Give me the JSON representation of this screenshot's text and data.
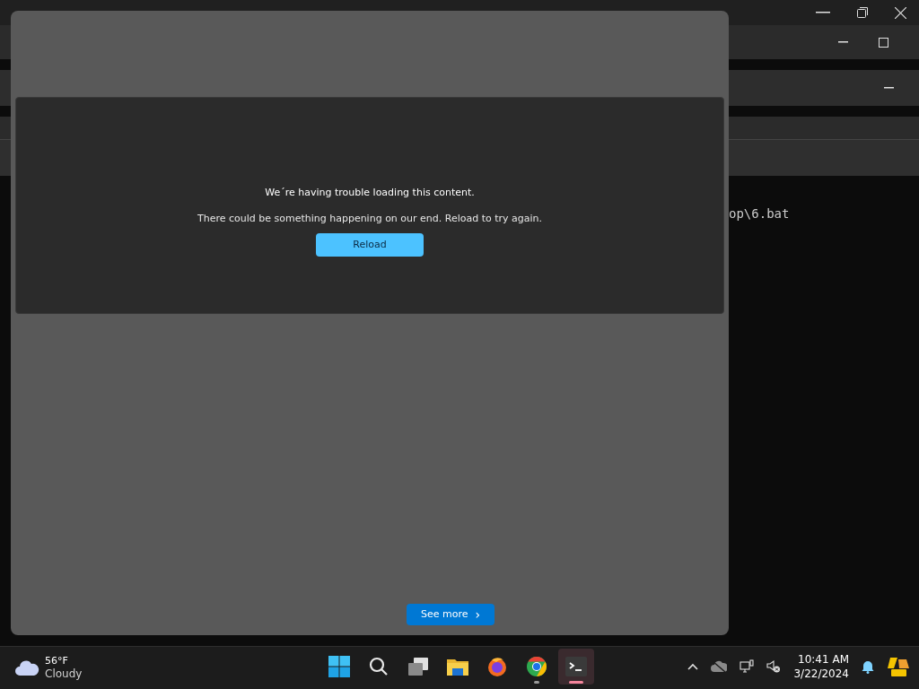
{
  "terminal": {
    "line": "op\\6.bat"
  },
  "dialog": {
    "heading": "We´re having trouble loading this content.",
    "message": "There could be something happening on our end. Reload to try again.",
    "reload_button": "Reload",
    "see_more_button": "See more",
    "see_more_arrow": "›"
  },
  "taskbar": {
    "weather": {
      "temperature": "56°F",
      "condition": "Cloudy"
    },
    "apps": [
      {
        "kind": "start",
        "running": false,
        "selected": false
      },
      {
        "kind": "search",
        "running": false,
        "selected": false
      },
      {
        "kind": "taskview",
        "running": false,
        "selected": false
      },
      {
        "kind": "explorer",
        "running": false,
        "selected": false
      },
      {
        "kind": "firefox",
        "running": false,
        "selected": false
      },
      {
        "kind": "chrome",
        "running": true,
        "selected": false
      },
      {
        "kind": "terminal",
        "running": true,
        "selected": true
      }
    ],
    "time": "10:41 AM",
    "date": "3/22/2024"
  }
}
